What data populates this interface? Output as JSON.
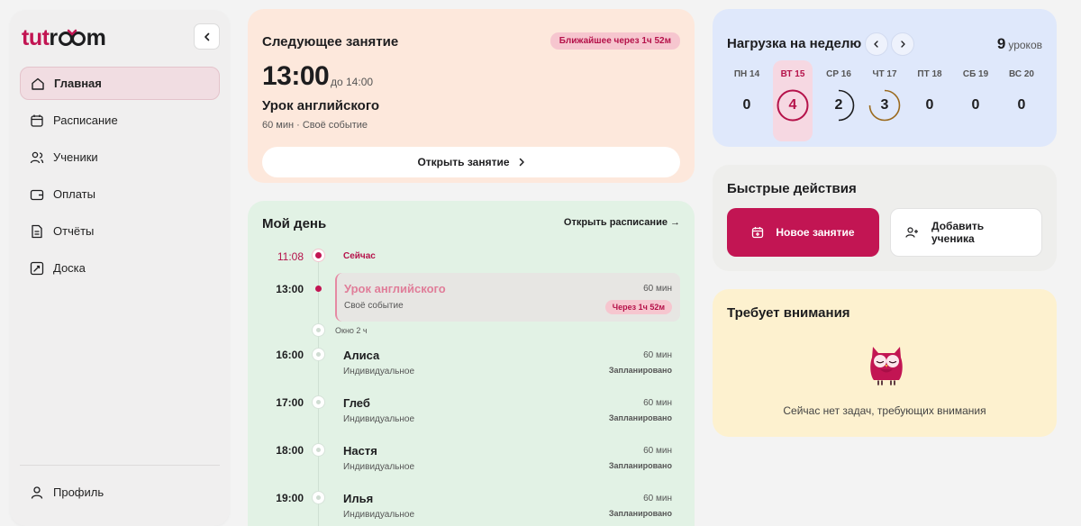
{
  "brand": {
    "part1": "tut",
    "part2": "r",
    "part3": "m"
  },
  "sidebar": {
    "items": [
      {
        "label": "Главная",
        "icon": "home-icon"
      },
      {
        "label": "Расписание",
        "icon": "calendar-icon"
      },
      {
        "label": "Ученики",
        "icon": "users-icon"
      },
      {
        "label": "Оплаты",
        "icon": "wallet-icon"
      },
      {
        "label": "Отчёты",
        "icon": "document-icon"
      },
      {
        "label": "Доска",
        "icon": "board-icon"
      }
    ],
    "profile": "Профиль"
  },
  "next_lesson": {
    "title": "Следующее занятие",
    "badge": "Ближайшее через 1ч 52м",
    "time": "13:00",
    "until": "до 14:00",
    "name": "Урок английского",
    "meta": "60 мин · Своё событие",
    "open_label": "Открыть занятие"
  },
  "my_day": {
    "title": "Мой день",
    "open_schedule": "Открыть расписание →",
    "now_time": "11:08",
    "now_label": "Сейчас",
    "lesson": {
      "time": "13:00",
      "name": "Урок английского",
      "sub": "Своё событие",
      "duration": "60 мин",
      "badge": "Через 1ч 52м"
    },
    "gap": "Окно 2 ч",
    "students": [
      {
        "time": "16:00",
        "name": "Алиса",
        "sub": "Индивидуальное",
        "duration": "60 мин",
        "status": "Запланировано"
      },
      {
        "time": "17:00",
        "name": "Глеб",
        "sub": "Индивидуальное",
        "duration": "60 мин",
        "status": "Запланировано"
      },
      {
        "time": "18:00",
        "name": "Настя",
        "sub": "Индивидуальное",
        "duration": "60 мин",
        "status": "Запланировано"
      },
      {
        "time": "19:00",
        "name": "Илья",
        "sub": "Индивидуальное",
        "duration": "60 мин",
        "status": "Запланировано"
      }
    ]
  },
  "week": {
    "title": "Нагрузка на неделю",
    "total_value": "9",
    "total_unit": "уроков",
    "days": [
      {
        "label": "ПН 14",
        "value": "0"
      },
      {
        "label": "ВТ 15",
        "value": "4",
        "selected": true
      },
      {
        "label": "СР 16",
        "value": "2"
      },
      {
        "label": "ЧТ 17",
        "value": "3"
      },
      {
        "label": "ПТ 18",
        "value": "0"
      },
      {
        "label": "СБ 19",
        "value": "0"
      },
      {
        "label": "ВС 20",
        "value": "0"
      }
    ]
  },
  "quick": {
    "title": "Быстрые действия",
    "new_lesson": "Новое занятие",
    "add_student_1": "Добавить",
    "add_student_2": "ученика"
  },
  "attention": {
    "title": "Требует внимания",
    "empty": "Сейчас нет задач, требующих внимания"
  },
  "colors": {
    "accent": "#c21553",
    "next_card": "#fde8dc",
    "day_card": "#e2f2e5",
    "week_card": "#dfe8fb",
    "attention_card": "#fdf1cf"
  }
}
